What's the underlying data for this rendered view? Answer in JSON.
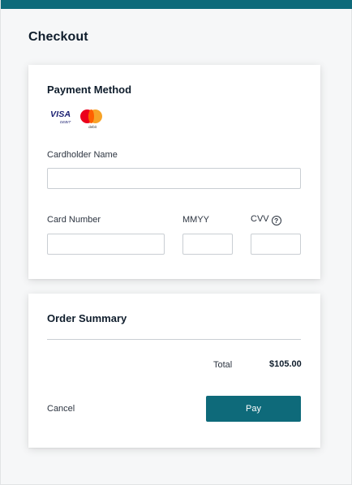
{
  "page": {
    "title": "Checkout"
  },
  "payment": {
    "section_title": "Payment Method",
    "accepted_cards": [
      {
        "icon": "visa-debit-logo",
        "text": "VISA",
        "subtext": "DEBIT"
      },
      {
        "icon": "mastercard-debit-logo",
        "subtext": "debit"
      }
    ],
    "cardholder_name": {
      "label": "Cardholder Name",
      "value": ""
    },
    "card_number": {
      "label": "Card Number",
      "value": ""
    },
    "expiry": {
      "label": "MMYY",
      "value": ""
    },
    "cvv": {
      "label": "CVV",
      "help_icon": "question-circle-icon",
      "value": ""
    }
  },
  "summary": {
    "section_title": "Order Summary",
    "total_label": "Total",
    "total_value": "$105.00",
    "cancel_label": "Cancel",
    "pay_label": "Pay"
  },
  "colors": {
    "accent": "#0e6a7a",
    "background": "#f6f7f8",
    "card": "#ffffff",
    "text": "#0f1d2c"
  }
}
